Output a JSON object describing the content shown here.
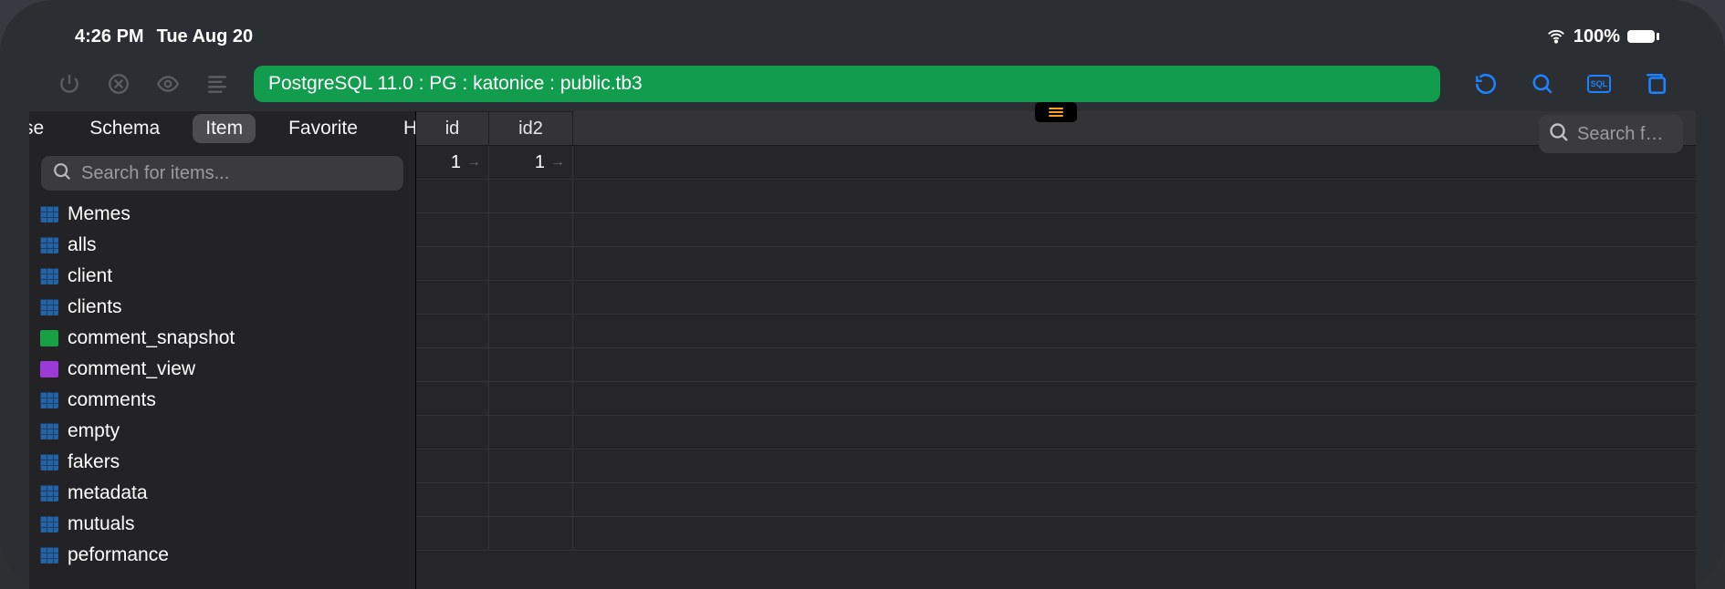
{
  "status": {
    "time": "4:26 PM",
    "date": "Tue Aug 20",
    "battery_pct": "100%"
  },
  "toolbar": {
    "breadcrumb": "PostgreSQL 11.0 : PG : katonice : public.tb3",
    "sql_label": "SQL"
  },
  "sidebar": {
    "tabs": [
      {
        "label": "se"
      },
      {
        "label": "Schema"
      },
      {
        "label": "Item",
        "active": true
      },
      {
        "label": "Favorite"
      },
      {
        "label": "H"
      }
    ],
    "search_placeholder": "Search for items...",
    "items": [
      {
        "name": "Memes",
        "icon": "table"
      },
      {
        "name": "alls",
        "icon": "table"
      },
      {
        "name": "client",
        "icon": "table"
      },
      {
        "name": "clients",
        "icon": "table"
      },
      {
        "name": "comment_snapshot",
        "icon": "snapshot"
      },
      {
        "name": "comment_view",
        "icon": "view"
      },
      {
        "name": "comments",
        "icon": "table"
      },
      {
        "name": "empty",
        "icon": "table"
      },
      {
        "name": "fakers",
        "icon": "table"
      },
      {
        "name": "metadata",
        "icon": "table"
      },
      {
        "name": "mutuals",
        "icon": "table"
      },
      {
        "name": "peformance",
        "icon": "table"
      }
    ]
  },
  "content": {
    "columns": [
      {
        "name": "id"
      },
      {
        "name": "id2"
      }
    ],
    "rows": [
      {
        "id": "1",
        "id2": "1"
      }
    ],
    "right_search_placeholder": "Search f…",
    "empty_row_count": 11
  },
  "colors": {
    "accent_blue": "#1e82ff",
    "addr_green": "#119c4e",
    "hamburger_orange": "#ff9e1f"
  }
}
